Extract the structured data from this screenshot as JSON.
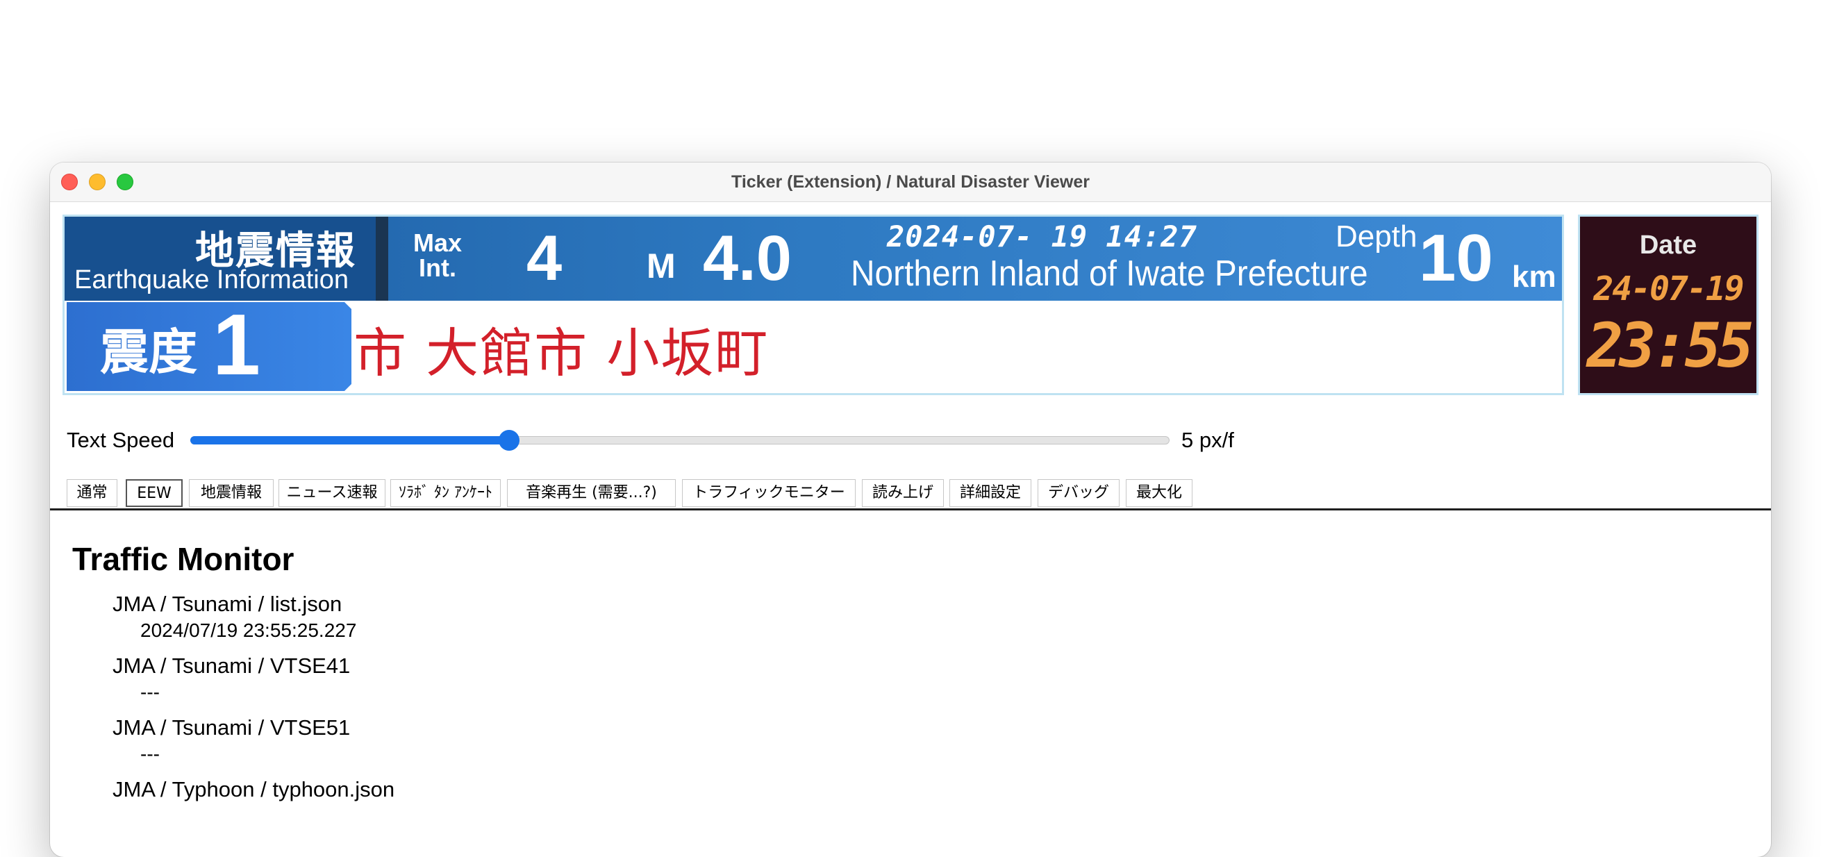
{
  "window": {
    "title": "Ticker (Extension) / Natural Disaster Viewer"
  },
  "ticker": {
    "title_ja": "地震情報",
    "title_en": "Earthquake Information",
    "max_int_label_1": "Max",
    "max_int_label_2": "Int.",
    "max_int_value": "4",
    "magnitude_label": "M",
    "magnitude_value": "4.0",
    "time": "2024-07- 19  14:27",
    "region": "Northern Inland of Iwate Prefecture",
    "depth_label": "Depth",
    "depth_value": "10",
    "depth_unit": "km",
    "intensity_label": "震度",
    "intensity_value": "1",
    "scroll_text": "角市 大館市 小坂町"
  },
  "clock": {
    "label": "Date",
    "date": "24-07-19",
    "time": "23:55"
  },
  "speed": {
    "label": "Text Speed",
    "value_text": "5 px/f",
    "fraction": 0.32
  },
  "tabs": [
    {
      "label": "通常"
    },
    {
      "label": "EEW"
    },
    {
      "label": "地震情報"
    },
    {
      "label": "ニュース速報"
    },
    {
      "label": "ｿﾗﾎﾞ ﾀﾝ ｱﾝｹｰﾄ"
    },
    {
      "label": "音楽再生 (需要...?)"
    },
    {
      "label": "トラフィックモニター"
    },
    {
      "label": "読み上げ"
    },
    {
      "label": "詳細設定"
    },
    {
      "label": "デバッグ"
    },
    {
      "label": "最大化"
    }
  ],
  "traffic": {
    "heading": "Traffic Monitor",
    "items": [
      {
        "name": "JMA / Tsunami / list.json",
        "value": "2024/07/19 23:55:25.227"
      },
      {
        "name": "JMA / Tsunami / VTSE41",
        "value": "---"
      },
      {
        "name": "JMA / Tsunami / VTSE51",
        "value": "---"
      },
      {
        "name": "JMA / Typhoon / typhoon.json",
        "value": ""
      }
    ]
  },
  "colors": {
    "accent": "#1a73e8",
    "ticker_blue": "#2e7ac2",
    "scroll_red": "#d3202a",
    "clock_bg": "#2e0d18",
    "clock_digits": "#f0a044"
  }
}
